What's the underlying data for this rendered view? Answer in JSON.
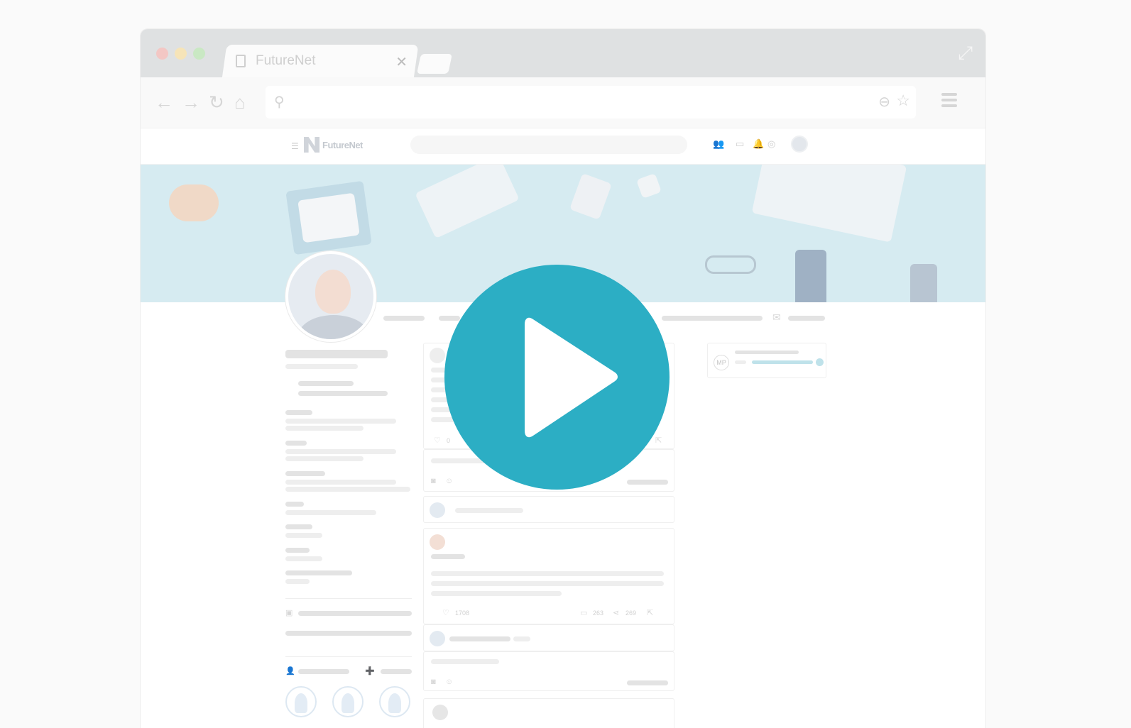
{
  "browser": {
    "tab_title": "FutureNet",
    "tab_close": "✕",
    "nav": {
      "back": "←",
      "forward": "→",
      "reload": "↻",
      "home": "⌂"
    },
    "icons": {
      "search": "search-icon",
      "zoom": "zoom-icon",
      "star": "star-icon",
      "menu": "menu-icon",
      "expand": "expand-icon"
    }
  },
  "site": {
    "brand": "FutureNet",
    "nav_icons": [
      "people-icon",
      "chat-icon",
      "bell-icon",
      "coin-icon"
    ]
  },
  "feed": {
    "post1": {
      "likes": "0"
    },
    "post2": {
      "likes": "1708",
      "comments": "263",
      "shares": "269"
    }
  },
  "sidebar_right": {
    "badge": "MP"
  },
  "colors": {
    "accent": "#2caec4",
    "banner": "#d6ebf1"
  }
}
